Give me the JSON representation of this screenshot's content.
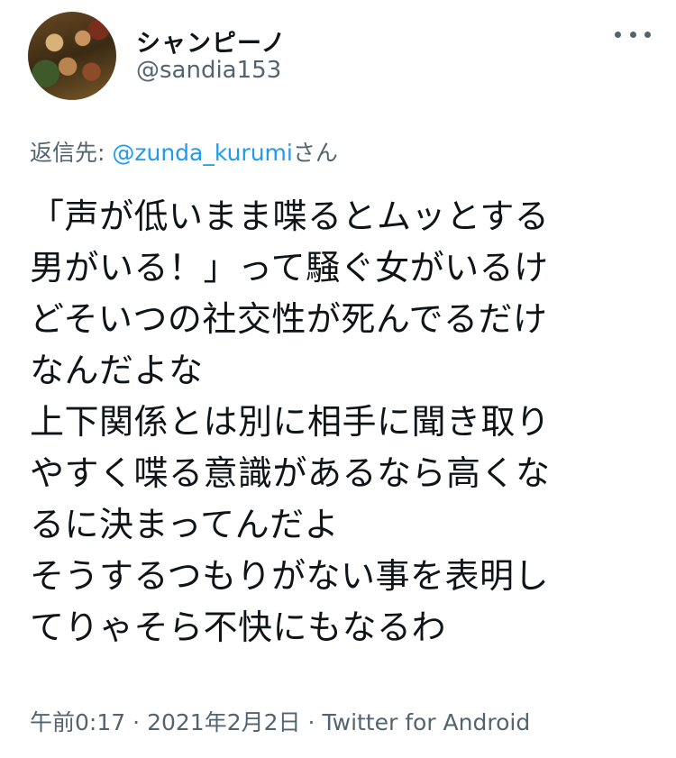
{
  "user": {
    "display_name": "シャンピーノ",
    "handle": "@sandia153"
  },
  "reply": {
    "prefix": "返信先: ",
    "mention": "@zunda_kurumi",
    "suffix": "さん"
  },
  "tweet": {
    "lines": [
      "「声が低いまま喋るとムッとする",
      "男がいる！」って騒ぐ女がいるけ",
      "どそいつの社交性が死んでるだけ",
      "なんだよな",
      "上下関係とは別に相手に聞き取り",
      "やすく喋る意識があるなら高くな",
      "るに決まってんだよ",
      "そうするつもりがない事を表明し",
      "てりゃそら不快にもなるわ"
    ]
  },
  "meta": {
    "time": "午前0:17",
    "separator": "·",
    "date": "2021年2月2日",
    "source": "Twitter for Android"
  },
  "icons": {
    "more": "more-horizontal-icon"
  },
  "colors": {
    "text": "#0f1419",
    "secondary": "#536471",
    "link": "#1d9bf0"
  }
}
